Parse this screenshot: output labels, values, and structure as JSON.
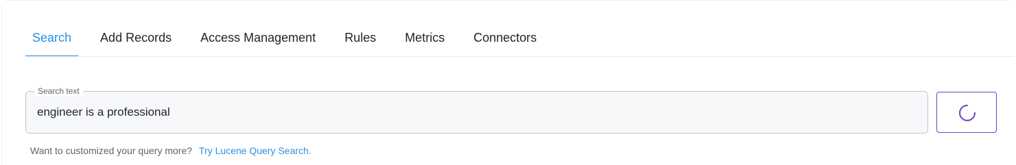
{
  "tabs": [
    {
      "label": "Search",
      "active": true
    },
    {
      "label": "Add Records",
      "active": false
    },
    {
      "label": "Access Management",
      "active": false
    },
    {
      "label": "Rules",
      "active": false
    },
    {
      "label": "Metrics",
      "active": false
    },
    {
      "label": "Connectors",
      "active": false
    }
  ],
  "search": {
    "label": "Search text",
    "value": "engineer is a professional",
    "button_state_icon": "loading-spinner-icon"
  },
  "hint": {
    "text": "Want to customized your query more?",
    "link_text": "Try Lucene Query Search."
  },
  "colors": {
    "accent": "#2a8fe0",
    "button_border": "#6a3fc0",
    "spinner": "#7b4cc9"
  }
}
